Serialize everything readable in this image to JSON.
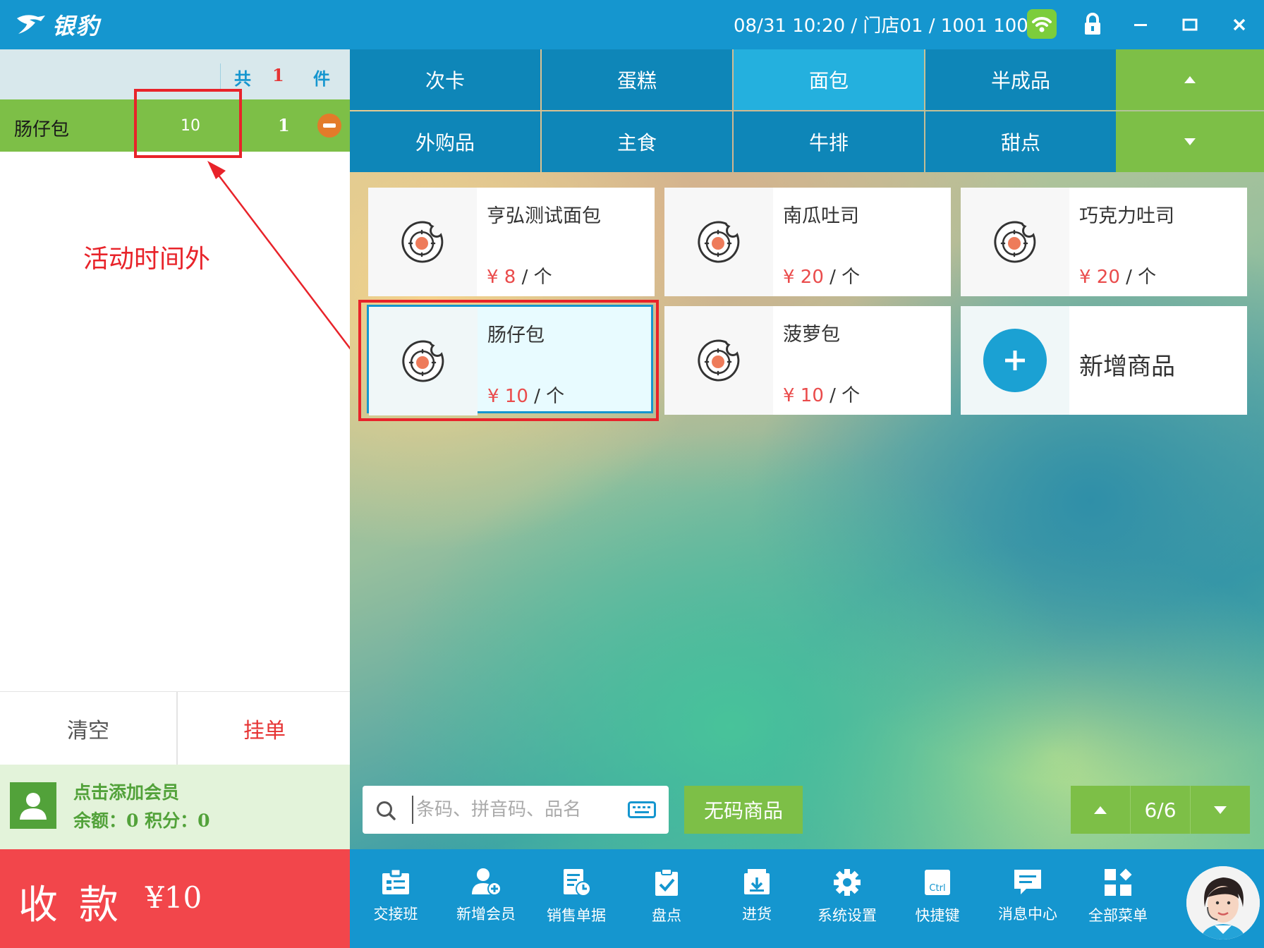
{
  "app": {
    "title": "银豹"
  },
  "status": {
    "datetime_store_user": "08/31 10:20 / 门店01 / 1001 1001"
  },
  "cart": {
    "total_prefix": "共",
    "total_count": "1",
    "total_suffix": "件",
    "items": [
      {
        "name": "肠仔包",
        "price": "10",
        "qty": "1"
      }
    ],
    "annotation": "活动时间外",
    "clear_label": "清空",
    "hold_label": "挂单"
  },
  "member": {
    "add_label": "点击添加会员",
    "balance_line": "余额：0   积分：0"
  },
  "payment": {
    "label": "收款",
    "amount": "¥10"
  },
  "categories": [
    {
      "label": "次卡"
    },
    {
      "label": "蛋糕"
    },
    {
      "label": "面包",
      "active": true
    },
    {
      "label": "半成品"
    },
    {
      "label": "外购品"
    },
    {
      "label": "主食"
    },
    {
      "label": "牛排"
    },
    {
      "label": "甜点"
    }
  ],
  "products": [
    {
      "name": "亨弘测试面包",
      "price": "¥ 8",
      "unit": " / 个"
    },
    {
      "name": "南瓜吐司",
      "price": "¥ 20",
      "unit": " / 个"
    },
    {
      "name": "巧克力吐司",
      "price": "¥ 20",
      "unit": " / 个"
    },
    {
      "name": "肠仔包",
      "price": "¥ 10",
      "unit": " / 个"
    },
    {
      "name": "菠萝包",
      "price": "¥ 10",
      "unit": " / 个"
    }
  ],
  "add_product": {
    "label": "新增商品"
  },
  "search": {
    "placeholder": "条码、拼音码、品名"
  },
  "no_code_label": "无码商品",
  "pager": {
    "page": "6/6"
  },
  "toolbar": [
    {
      "label": "交接班",
      "icon": "handover-icon"
    },
    {
      "label": "新增会员",
      "icon": "add-member-icon"
    },
    {
      "label": "销售单据",
      "icon": "sales-docs-icon"
    },
    {
      "label": "盘点",
      "icon": "stocktake-icon"
    },
    {
      "label": "进货",
      "icon": "purchase-icon"
    },
    {
      "label": "系统设置",
      "icon": "gear-icon"
    },
    {
      "label": "快捷键",
      "icon": "ctrl-key-icon"
    },
    {
      "label": "消息中心",
      "icon": "message-icon"
    },
    {
      "label": "全部菜单",
      "icon": "all-menu-icon"
    }
  ],
  "colors": {
    "primary": "#1596cf",
    "accent_green": "#7dbf47",
    "pay_red": "#f2464b",
    "price_red": "#ea4b4b",
    "highlight_red": "#e8232a"
  }
}
